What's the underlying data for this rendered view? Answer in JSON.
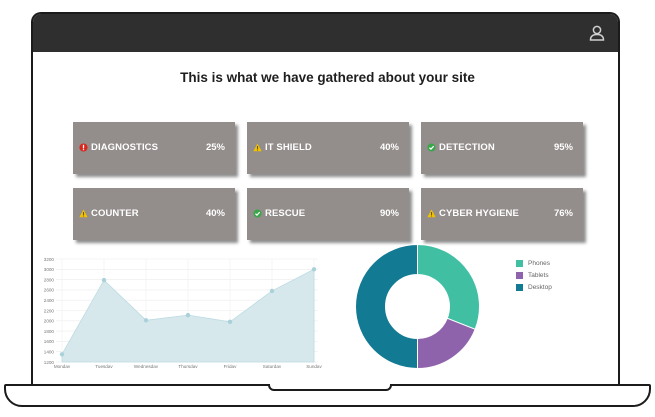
{
  "heading": "This is what we have gathered about your site",
  "cards": [
    {
      "label": "DIAGNOSTICS",
      "value": "25%",
      "status": "error",
      "icon": "error-icon"
    },
    {
      "label": "IT SHIELD",
      "value": "40%",
      "status": "warning",
      "icon": "warning-icon"
    },
    {
      "label": "DETECTION",
      "value": "95%",
      "status": "ok",
      "icon": "check-icon"
    },
    {
      "label": "COUNTER",
      "value": "40%",
      "status": "warning",
      "icon": "warning-icon"
    },
    {
      "label": "RESCUE",
      "value": "90%",
      "status": "ok",
      "icon": "check-icon"
    },
    {
      "label": "CYBER HYGIENE",
      "value": "76%",
      "status": "warning",
      "icon": "warning-icon"
    }
  ],
  "colors": {
    "card": "#938d8b",
    "error": "#d9261c",
    "warning": "#f2c200",
    "ok": "#3aa64a",
    "area_fill": "#d6e8ec",
    "area_line": "#bcdbe2",
    "point": "#a9d1da"
  },
  "chart_data": [
    {
      "type": "area",
      "categories": [
        "Monday",
        "Tuesday",
        "Wednesday",
        "Thursday",
        "Friday",
        "Saturday",
        "Sunday"
      ],
      "values": [
        1350,
        2790,
        2010,
        2110,
        1980,
        2580,
        3000
      ],
      "y_ticks": [
        "1200",
        "1400",
        "1600",
        "1800",
        "2000",
        "2200",
        "2400",
        "2600",
        "2800",
        "3000",
        "3200"
      ],
      "ylim": [
        1200,
        3200
      ],
      "grid": true
    },
    {
      "type": "pie",
      "donut": true,
      "labels": [
        "Phones",
        "Tablets",
        "Desktop"
      ],
      "values": [
        0.31,
        0.19,
        0.5
      ],
      "colors": [
        "#41bfa2",
        "#8f62ac",
        "#127a93"
      ],
      "legend": "right"
    }
  ]
}
